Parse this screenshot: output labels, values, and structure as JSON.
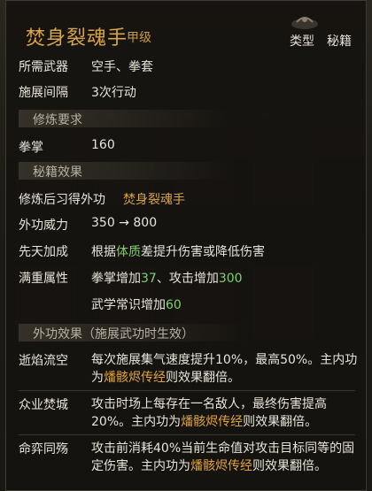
{
  "header": {
    "title": "焚身裂魂手",
    "grade": "甲级",
    "type_label": "类型",
    "type_value": "秘籍"
  },
  "basic": [
    {
      "label": "所需武器",
      "value": "空手、拳套"
    },
    {
      "label": "施展间隔",
      "value": "3次行动"
    }
  ],
  "requirements": {
    "section_title": "修炼要求",
    "label": "拳掌",
    "value": "160"
  },
  "effects": {
    "section_title": "秘籍效果",
    "learn_label": "修炼后习得外功",
    "learn_value": "焚身裂魂手",
    "power_label": "外功威力",
    "power_from": "350",
    "power_arrow": "→",
    "power_to": "800",
    "innate_label": "先天加成",
    "innate_pre": "根据",
    "innate_attr": "体质",
    "innate_post": "差提升伤害或降低伤害",
    "max_label": "满重属性",
    "max_line1_a": "拳掌增加",
    "max_line1_b": "37",
    "max_line1_c": "、攻击增加",
    "max_line1_d": "300",
    "max_line2_a": "武学常识增加",
    "max_line2_b": "60"
  },
  "skill_effects": {
    "section_title": "外功效果（施展武功时生效）",
    "items": [
      {
        "name": "逝焰流空",
        "text_a": "每次施展集气速度提升10%，最高50%。主内功为",
        "kw": "燔骸烬传经",
        "text_b": "则效果翻倍。"
      },
      {
        "name": "众业焚城",
        "text_a": "攻击时场上每存在一名敌人，最终伤害提高20%。主内功为",
        "kw": "燔骸烬传经",
        "text_b": "则效果翻倍。"
      },
      {
        "name": "命弈同殇",
        "text_a": "攻击前消耗40%当前生命值对攻击目标同等的固定伤害。主内功为",
        "kw": "燔骸烬传经",
        "text_b": "则效果翻倍。"
      }
    ]
  },
  "colors": {
    "title": "#d9a54a",
    "keyword": "#e2a43a",
    "number": "#7cd46a",
    "text": "#e8e4da"
  }
}
